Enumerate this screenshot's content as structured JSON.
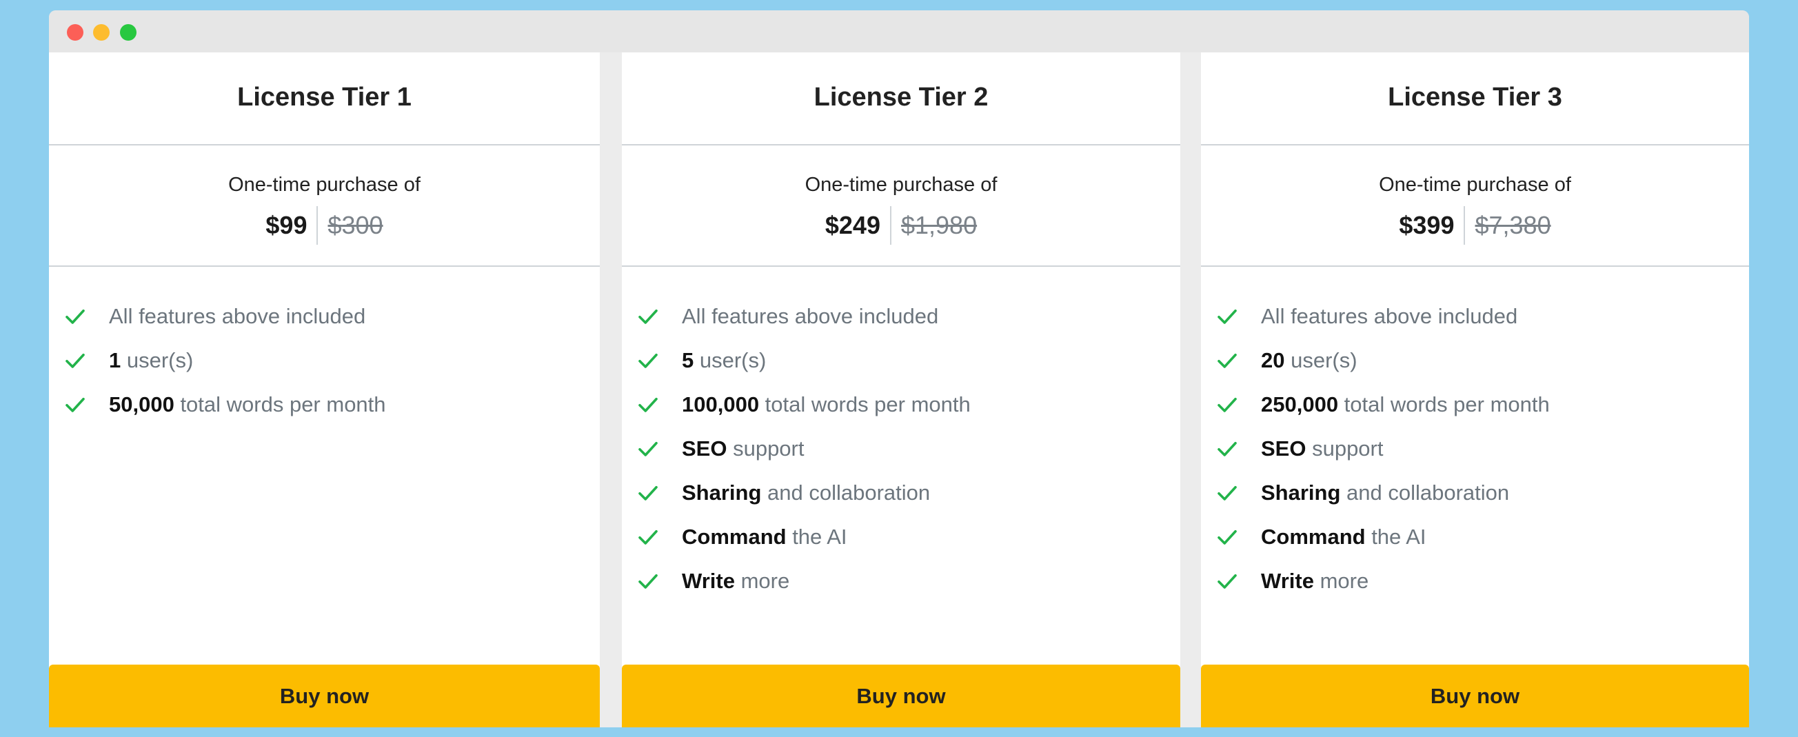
{
  "colors": {
    "background": "#8ecfef",
    "accent": "#fcbc00",
    "check": "#22b34a",
    "muted_text": "#6c757d",
    "strike_text": "#7b8289"
  },
  "tiers": [
    {
      "title": "License Tier 1",
      "caption": "One-time purchase of",
      "price": "$99",
      "old_price": "$300",
      "features": [
        {
          "bold": "",
          "text": "All features above included"
        },
        {
          "bold": "1",
          "text": " user(s)"
        },
        {
          "bold": "50,000",
          "text": " total words per month"
        }
      ],
      "button": "Buy now"
    },
    {
      "title": "License Tier 2",
      "caption": "One-time purchase of",
      "price": "$249",
      "old_price": "$1,980",
      "features": [
        {
          "bold": "",
          "text": "All features above included"
        },
        {
          "bold": "5",
          "text": " user(s)"
        },
        {
          "bold": "100,000",
          "text": " total words per month"
        },
        {
          "bold": "SEO",
          "text": " support"
        },
        {
          "bold": "Sharing",
          "text": " and collaboration"
        },
        {
          "bold": "Command",
          "text": " the AI"
        },
        {
          "bold": "Write",
          "text": " more"
        }
      ],
      "button": "Buy now"
    },
    {
      "title": "License Tier 3",
      "caption": "One-time purchase of",
      "price": "$399",
      "old_price": "$7,380",
      "features": [
        {
          "bold": "",
          "text": "All features above included"
        },
        {
          "bold": "20",
          "text": " user(s)"
        },
        {
          "bold": "250,000",
          "text": " total words per month"
        },
        {
          "bold": "SEO",
          "text": " support"
        },
        {
          "bold": "Sharing",
          "text": " and collaboration"
        },
        {
          "bold": "Command",
          "text": " the AI"
        },
        {
          "bold": "Write",
          "text": " more"
        }
      ],
      "button": "Buy now"
    }
  ]
}
